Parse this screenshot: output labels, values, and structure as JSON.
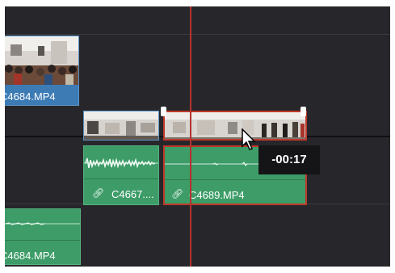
{
  "clips": {
    "video_top": {
      "name": "C4684.MP4"
    },
    "video_mid_left": {
      "name": ""
    },
    "video_mid_right": {
      "name": ""
    },
    "audio_mid_left": {
      "name": "C4667...."
    },
    "audio_mid_right": {
      "name": "C4689.MP4"
    },
    "audio_bottom": {
      "name": "C4684.MP4"
    }
  },
  "tooltip": {
    "text": "-00:17"
  },
  "icons": {
    "link": "link-icon",
    "cursor": "arrow-cursor-icon"
  },
  "colors": {
    "timeline_bg": "#27272b",
    "video_clip": "#3d7bb5",
    "audio_clip": "#3d9c68",
    "selection": "#c0392b",
    "playhead": "#b4322e"
  }
}
